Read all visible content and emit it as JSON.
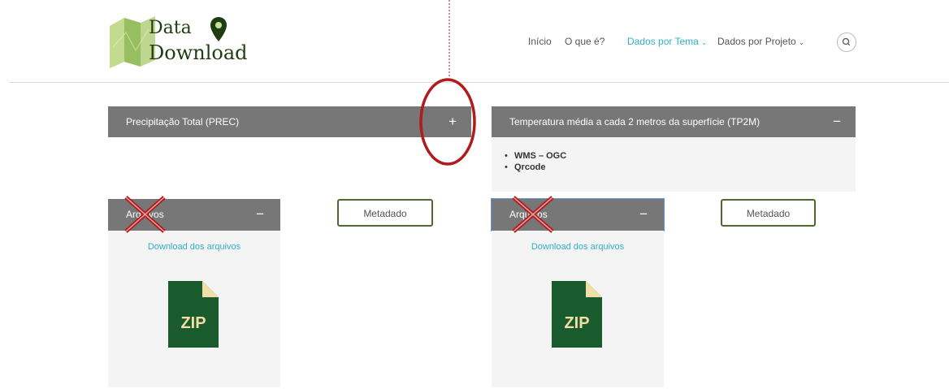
{
  "logo": {
    "line1": "Data",
    "line2": "Download"
  },
  "nav": {
    "items": [
      {
        "label": "Início"
      },
      {
        "label": "O que é?"
      },
      {
        "label": "Dados por Tema",
        "chevron": "⌄",
        "active": true
      },
      {
        "label": "Dados por Projeto",
        "chevron": "⌄"
      }
    ],
    "search_icon": "search-icon"
  },
  "panels": {
    "left": {
      "title": "Precipitação Total (PREC)",
      "toggle": "+",
      "files": {
        "title": "Arquivos",
        "toggle": "−",
        "download_link": "Download dos arquivos",
        "zip_label": "ZIP"
      },
      "metadata_label": "Metadado"
    },
    "right": {
      "title": "Temperatura média a cada 2 metros da superfície (TP2M)",
      "toggle": "−",
      "items": [
        "WMS – OGC",
        "Qrcode"
      ],
      "files": {
        "title": "Arquivos",
        "toggle": "−",
        "download_link": "Download dos arquivos",
        "zip_label": "ZIP"
      },
      "metadata_label": "Metadado"
    }
  },
  "colors": {
    "accent": "#2fb1c6",
    "panel_header": "#777777",
    "zip_green": "#1a5b2e",
    "annotation_red": "#b01b1b"
  }
}
